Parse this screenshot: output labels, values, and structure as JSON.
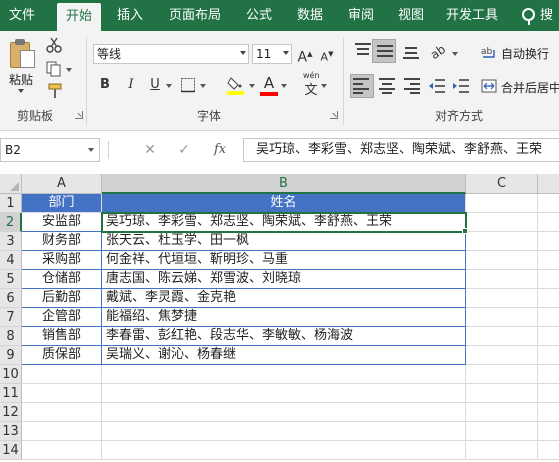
{
  "ribbon_tabs": [
    {
      "label": "文件"
    },
    {
      "label": "开始",
      "active": true
    },
    {
      "label": "插入"
    },
    {
      "label": "页面布局"
    },
    {
      "label": "公式"
    },
    {
      "label": "数据"
    },
    {
      "label": "审阅"
    },
    {
      "label": "视图"
    },
    {
      "label": "开发工具"
    },
    {
      "label": "搜"
    }
  ],
  "clipboard": {
    "paste_label": "粘贴",
    "group_label": "剪贴板",
    "icons": [
      "cut-icon",
      "copy-icon",
      "format-painter-icon"
    ]
  },
  "font": {
    "family": "等线",
    "size": "11",
    "grow_icon": "A",
    "shrink_icon": "A",
    "bold_label": "B",
    "italic_label": "I",
    "underline_label": "U",
    "phonetic_label": "wén",
    "fill_color": "#ffff00",
    "font_color": "#ff0000",
    "group_label": "字体"
  },
  "alignment": {
    "wrap_text_label": "自动换行",
    "merge_center_label": "合并后居中",
    "group_label": "对齐方式",
    "orientation_icon": "ab"
  },
  "formula_bar": {
    "name_box": "B2",
    "cancel_icon": "✕",
    "enter_icon": "✓",
    "fx_label": "fx",
    "content": "吴巧琼、李彩雪、郑志坚、陶荣斌、李舒燕、王荣"
  },
  "sheet": {
    "columns": [
      "A",
      "B",
      "C"
    ],
    "row_numbers": [
      "1",
      "2",
      "3",
      "4",
      "5",
      "6",
      "7",
      "8",
      "9",
      "10",
      "11",
      "12",
      "13",
      "14"
    ],
    "header_row": [
      "部门",
      "姓名"
    ],
    "rows": [
      [
        "安监部",
        "吴巧琼、李彩雪、郑志坚、陶荣斌、李舒燕、王荣"
      ],
      [
        "财务部",
        "张天云、杜玉学、田一枫"
      ],
      [
        "采购部",
        "何金祥、代垣垣、靳明珍、马重"
      ],
      [
        "仓储部",
        "唐志国、陈云娣、郑雪波、刘晓琼"
      ],
      [
        "后勤部",
        "戴斌、李灵霞、金克艳"
      ],
      [
        "企管部",
        "能福绍、焦梦捷"
      ],
      [
        "销售部",
        "李春雷、彭红艳、段志华、李敏敏、杨海波"
      ],
      [
        "质保部",
        "吴瑞义、谢沁、杨春继"
      ]
    ],
    "table_header_color": "#4472c4",
    "selected_cell": "B2"
  }
}
